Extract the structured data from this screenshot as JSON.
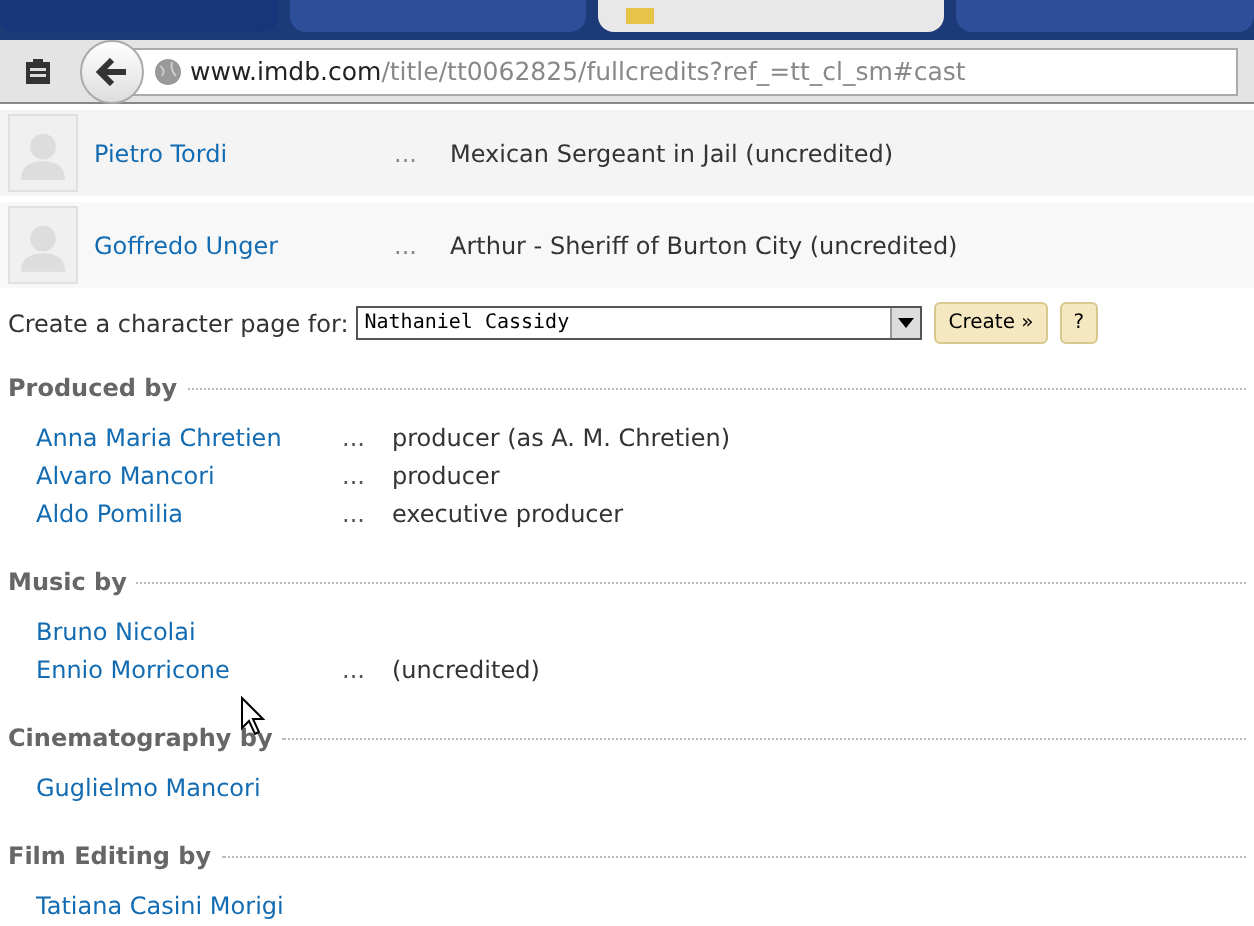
{
  "browser": {
    "tabs": [
      {
        "selected": false
      },
      {
        "selected": false
      },
      {
        "selected": true
      },
      {
        "selected": false
      }
    ],
    "url_host": "www.imdb.com",
    "url_path": "/title/tt0062825/fullcredits?ref_=tt_cl_sm#cast"
  },
  "cast": [
    {
      "name": "Pietro Tordi",
      "separator": "...",
      "character": "Mexican Sergeant in Jail (uncredited)"
    },
    {
      "name": "Goffredo Unger",
      "separator": "...",
      "character": "Arthur - Sheriff of Burton City (uncredited)"
    }
  ],
  "character_page": {
    "label": "Create a character page for:",
    "value": "Nathaniel Cassidy",
    "create_button": "Create »",
    "help_button": "?"
  },
  "sections": [
    {
      "heading": "Produced by",
      "credits": [
        {
          "name": "Anna Maria Chretien",
          "separator": "...",
          "role": "producer (as A. M. Chretien)"
        },
        {
          "name": "Alvaro Mancori",
          "separator": "...",
          "role": "producer"
        },
        {
          "name": "Aldo Pomilia",
          "separator": "...",
          "role": "executive producer"
        }
      ]
    },
    {
      "heading": "Music by",
      "credits": [
        {
          "name": "Bruno Nicolai"
        },
        {
          "name": "Ennio Morricone",
          "separator": "...",
          "role": "(uncredited)"
        }
      ]
    },
    {
      "heading": "Cinematography by",
      "credits": [
        {
          "name": "Guglielmo Mancori"
        }
      ]
    },
    {
      "heading": "Film Editing by",
      "credits": [
        {
          "name": "Tatiana Casini Morigi"
        }
      ]
    }
  ]
}
